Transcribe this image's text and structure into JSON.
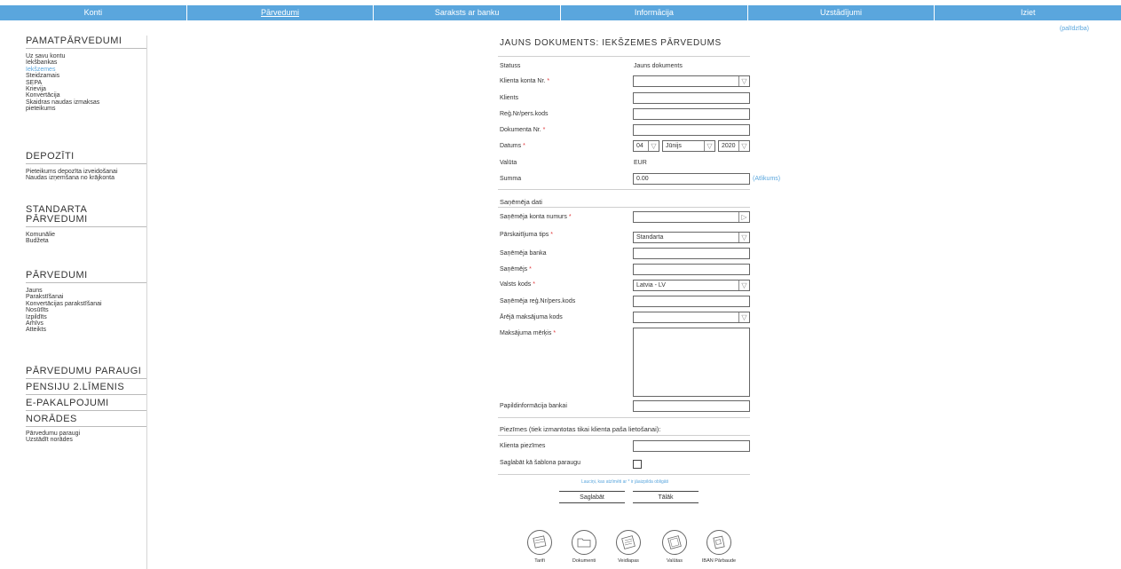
{
  "nav": {
    "items": [
      {
        "label": "Konti",
        "active": false
      },
      {
        "label": "Pārvedumi",
        "active": true
      },
      {
        "label": "Saraksts ar banku",
        "active": false
      },
      {
        "label": "Informācija",
        "active": false
      },
      {
        "label": "Uzstādījumi",
        "active": false
      },
      {
        "label": "Iziet",
        "active": false
      }
    ],
    "help": "(palīdzība)"
  },
  "sidebar": {
    "pamat": {
      "title": "PAMATPĀRVEDUMI",
      "items": [
        "Uz savu kontu",
        "Iekšbankas",
        "Iekšzemes",
        "Steidzamais",
        "SEPA",
        "Krievija",
        "Konvertācija",
        "Skaidras naudas izmaksas",
        "pieteikums"
      ],
      "active_index": 2
    },
    "depoziti": {
      "title": "DEPOZĪTI",
      "items": [
        "Pieteikums depozīta izveidošanai",
        "Naudas izņemšana no krājkonta"
      ]
    },
    "standarta": {
      "title_line1": "STANDARTA",
      "title_line2": "PĀRVEDUMI",
      "items": [
        "Komunālie",
        "Budžeta"
      ]
    },
    "parvedumi": {
      "title": "PĀRVEDUMI",
      "items": [
        "Jauns",
        "Parakstīšanai",
        "Konvertācijas parakstīšanai",
        "Nosūtīts",
        "Izpildīts",
        "Arhīvs",
        "Atteikts"
      ]
    },
    "links": [
      "PĀRVEDUMU PARAUGI",
      "PENSIJU 2.LĪMENIS",
      "E-PAKALPOJUMI",
      "NORĀDES"
    ],
    "bottom_items": [
      "Pārvedumu paraugi",
      "Uzstādīt norādes"
    ]
  },
  "form": {
    "title": "JAUNS DOKUMENTS: IEKŠZEMES PĀRVEDUMS",
    "status_label": "Statuss",
    "status_value": "Jauns dokuments",
    "account_label": "Klienta konta Nr.",
    "account_value": "",
    "client_label": "Klients",
    "client_value": "",
    "reg_label": "Reģ.Nr/pers.kods",
    "reg_value": "",
    "docnr_label": "Dokumenta Nr.",
    "docnr_value": "",
    "date_label": "Datums",
    "date_day": "04",
    "date_month": "Jūnijs",
    "date_year": "2020",
    "currency_label": "Valūta",
    "currency_value": "EUR",
    "sum_label": "Summa",
    "sum_value": "0.00",
    "sum_link": "(Atlikums)",
    "recipient_head": "Saņēmēja dati",
    "r_account_label": "Saņēmēja konta numurs",
    "r_account_value": "",
    "type_label": "Pārskaitījuma tips",
    "type_value": "Standarta",
    "r_bank_label": "Saņēmēja banka",
    "r_bank_value": "",
    "r_name_label": "Saņēmējs",
    "r_name_value": "",
    "country_label": "Valsts kods",
    "country_value": "Latvia - LV",
    "r_reg_label": "Saņēmēja reģ.Nr/pers.kods",
    "r_reg_value": "",
    "ext_label": "Ārējā maksājuma kods",
    "ext_value": "",
    "purpose_label": "Maksājuma mērķis",
    "extra_label": "Papildinformācija bankai",
    "extra_value": "",
    "notes_head": "Piezīmes (tiek izmantotas tikai klienta paša lietošanai):",
    "notes_label": "Klienta piezīmes",
    "notes_value": "",
    "template_label": "Saglabāt kā šablona paraugu",
    "required_mark": "*",
    "required_note": "Lauciņi, kas atzīmēti ar * ir jāaizpilda obligāti",
    "save_label": "Saglabāt",
    "next_label": "Tālāk"
  },
  "bottom_icons": [
    {
      "label": "Tarifi",
      "icon": "tariffs-icon"
    },
    {
      "label": "Dokumenti",
      "icon": "documents-icon"
    },
    {
      "label": "Veidlapas",
      "icon": "forms-icon"
    },
    {
      "label": "Valūtas",
      "icon": "currency-icon"
    },
    {
      "label": "IBAN Pārbaude",
      "icon": "iban-check-icon"
    }
  ]
}
